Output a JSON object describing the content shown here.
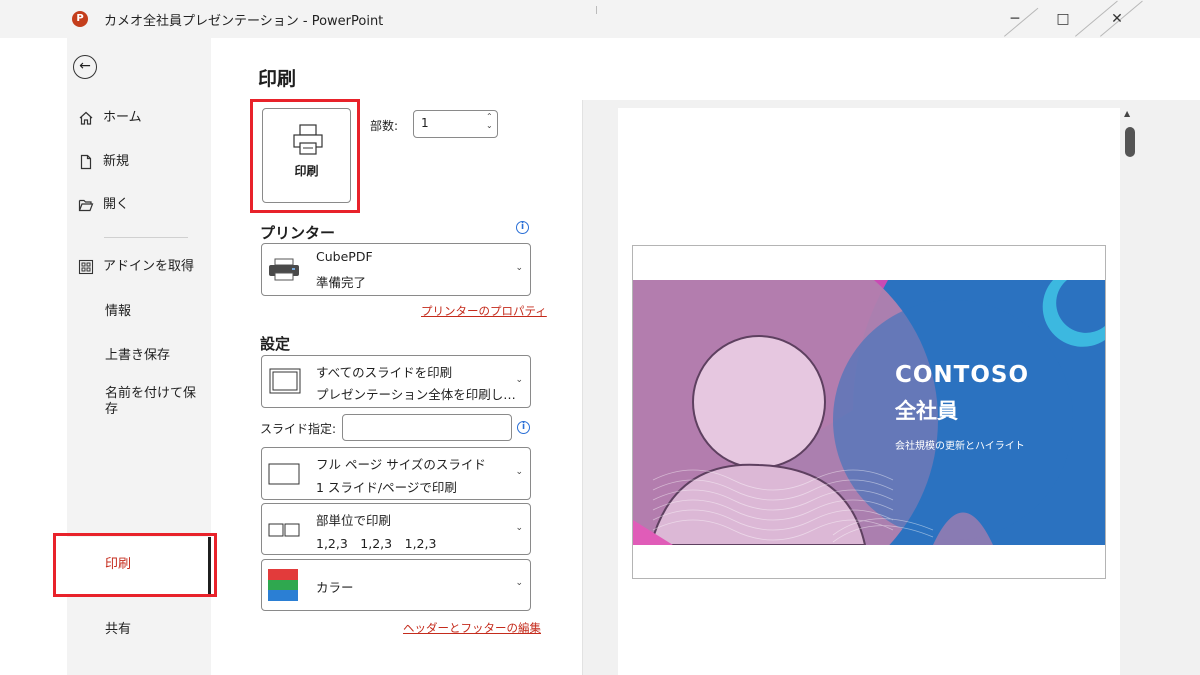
{
  "window": {
    "title": "カメオ全社員プレゼンテーション - PowerPoint",
    "app_icon_letter": "P",
    "controls": {
      "minimize": "─",
      "maximize": "□",
      "close": "✕"
    }
  },
  "sidebar": {
    "back_symbol": "←",
    "items": [
      {
        "label": "ホーム",
        "icon": "home-icon"
      },
      {
        "label": "新規",
        "icon": "new-document-icon"
      },
      {
        "label": "開く",
        "icon": "folder-open-icon"
      },
      {
        "label": "アドインを取得",
        "icon": "addins-grid-icon"
      },
      {
        "label": "情報"
      },
      {
        "label": "上書き保存"
      },
      {
        "label": "名前を付けて保存"
      },
      {
        "label": "印刷",
        "selected": true
      },
      {
        "label": "共有"
      }
    ]
  },
  "print_panel": {
    "heading": "印刷",
    "print_button_label": "印刷",
    "copies_label": "部数:",
    "copies_value": "1",
    "printer": {
      "section_title": "プリンター",
      "name": "CubePDF",
      "status": "準備完了",
      "properties_link": "プリンターのプロパティ"
    },
    "settings": {
      "section_title": "設定",
      "range": {
        "line1": "すべてのスライドを印刷",
        "line2": "プレゼンテーション全体を印刷し…"
      },
      "slides_label": "スライド指定:",
      "slides_value": "",
      "layout": {
        "line1": "フル ページ サイズのスライド",
        "line2": "1 スライド/ページで印刷"
      },
      "collation": {
        "line1": "部単位で印刷",
        "line2": "1,2,3　1,2,3　1,2,3"
      },
      "color": {
        "label": "カラー"
      },
      "header_footer_link": "ヘッダーとフッターの編集"
    }
  },
  "preview": {
    "slide_title_line1": "CONTOSO",
    "slide_title_line2": "全社員",
    "slide_subtitle": "会社規模の更新とハイライト"
  },
  "colors": {
    "accent_red": "#c42b1c",
    "highlight_box": "#e8222a",
    "slide_blue": "#2b72c0",
    "slide_pink": "#c94bb4",
    "slide_mauve": "#b27fae",
    "slide_cyan": "#3cb8e0",
    "info_blue": "#2a6fd6"
  }
}
